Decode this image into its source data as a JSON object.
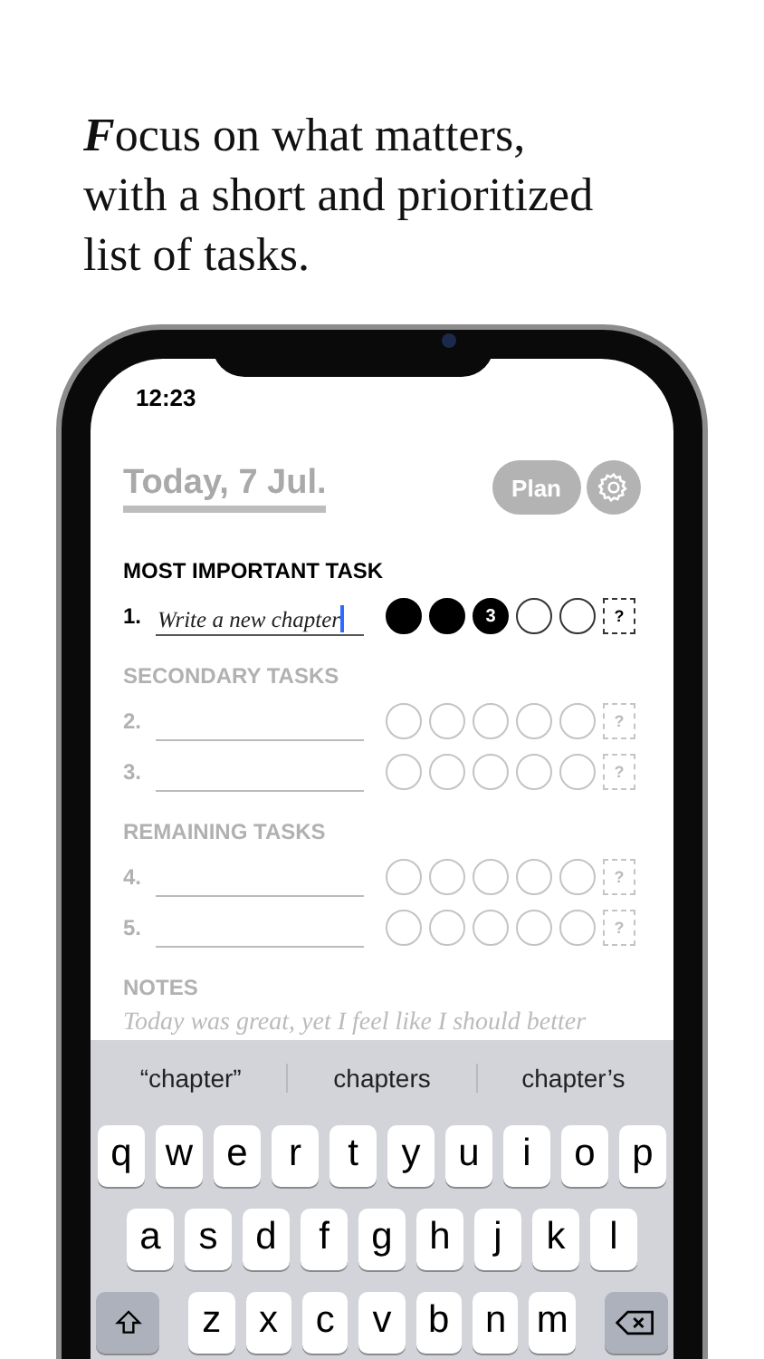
{
  "headline": [
    "**F**ocus on what matters,",
    "with a short and prioritized",
    "list of tasks."
  ],
  "status_bar": {
    "time": "12:23"
  },
  "header": {
    "date": "Today, 7 Jul.",
    "plan_button": "Plan"
  },
  "sections": [
    {
      "title": "MOST IMPORTANT TASK",
      "active": true,
      "tasks": [
        {
          "number": "1.",
          "value": "Write a new chapter",
          "focused": true,
          "help": "?",
          "circles": [
            {
              "filled": true
            },
            {
              "filled": true
            },
            {
              "filled": true,
              "label": "3"
            },
            {
              "filled": false
            },
            {
              "filled": false
            }
          ]
        }
      ]
    },
    {
      "title": "SECONDARY TASKS",
      "active": false,
      "tasks": [
        {
          "number": "2.",
          "focused": false,
          "help": "?",
          "circles": [
            {
              "filled": false
            },
            {
              "filled": false
            },
            {
              "filled": false
            },
            {
              "filled": false
            },
            {
              "filled": false
            }
          ]
        },
        {
          "number": "3.",
          "focused": false,
          "help": "?",
          "circles": [
            {
              "filled": false
            },
            {
              "filled": false
            },
            {
              "filled": false
            },
            {
              "filled": false
            },
            {
              "filled": false
            }
          ]
        }
      ]
    },
    {
      "title": "REMAINING TASKS",
      "active": false,
      "tasks": [
        {
          "number": "4.",
          "focused": false,
          "help": "?",
          "circles": [
            {
              "filled": false
            },
            {
              "filled": false
            },
            {
              "filled": false
            },
            {
              "filled": false
            },
            {
              "filled": false
            }
          ]
        },
        {
          "number": "5.",
          "focused": false,
          "help": "?",
          "circles": [
            {
              "filled": false
            },
            {
              "filled": false
            },
            {
              "filled": false
            },
            {
              "filled": false
            },
            {
              "filled": false
            }
          ]
        }
      ]
    }
  ],
  "notes": {
    "title": "NOTES",
    "text": "Today was great, yet I feel like I should better"
  },
  "keyboard": {
    "suggestions": [
      "“chapter”",
      "chapters",
      "chapter’s"
    ],
    "rows": [
      [
        "q",
        "w",
        "e",
        "r",
        "t",
        "y",
        "u",
        "i",
        "o",
        "p"
      ],
      [
        "a",
        "s",
        "d",
        "f",
        "g",
        "h",
        "j",
        "k",
        "l"
      ],
      [
        "z",
        "x",
        "c",
        "v",
        "b",
        "n",
        "m"
      ]
    ]
  }
}
